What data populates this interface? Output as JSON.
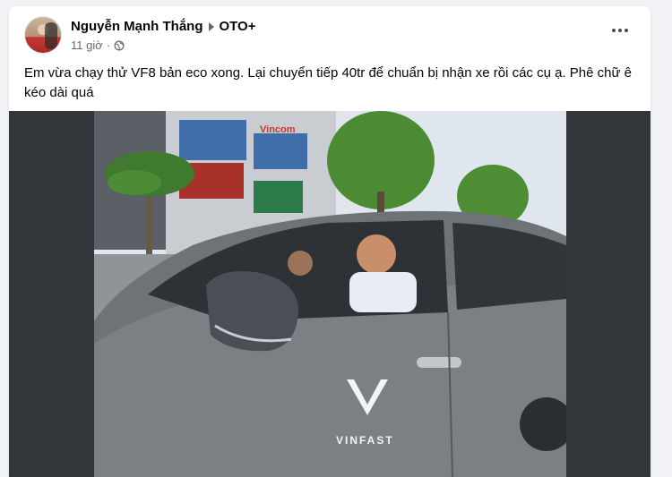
{
  "post": {
    "author": "Nguyễn Mạnh Thắng",
    "group": "OTO+",
    "time": "11 giờ",
    "separator": "·",
    "text": "Em vừa chạy thử VF8 bản eco xong. Lại chuyển tiếp 40tr để chuẩn bị nhận xe rồi các cụ ạ. Phê chữ ê kéo dài quá",
    "photo": {
      "storefront_sign": "Vincom",
      "car_logo": "VINFAST"
    }
  },
  "icons": {
    "visibility": "globe-icon",
    "group_arrow": "arrow-right-icon",
    "menu": "more-options-icon"
  },
  "colors": {
    "text_primary": "#050505",
    "text_secondary": "#65676b",
    "background": "#f0f2f5",
    "card": "#ffffff"
  }
}
